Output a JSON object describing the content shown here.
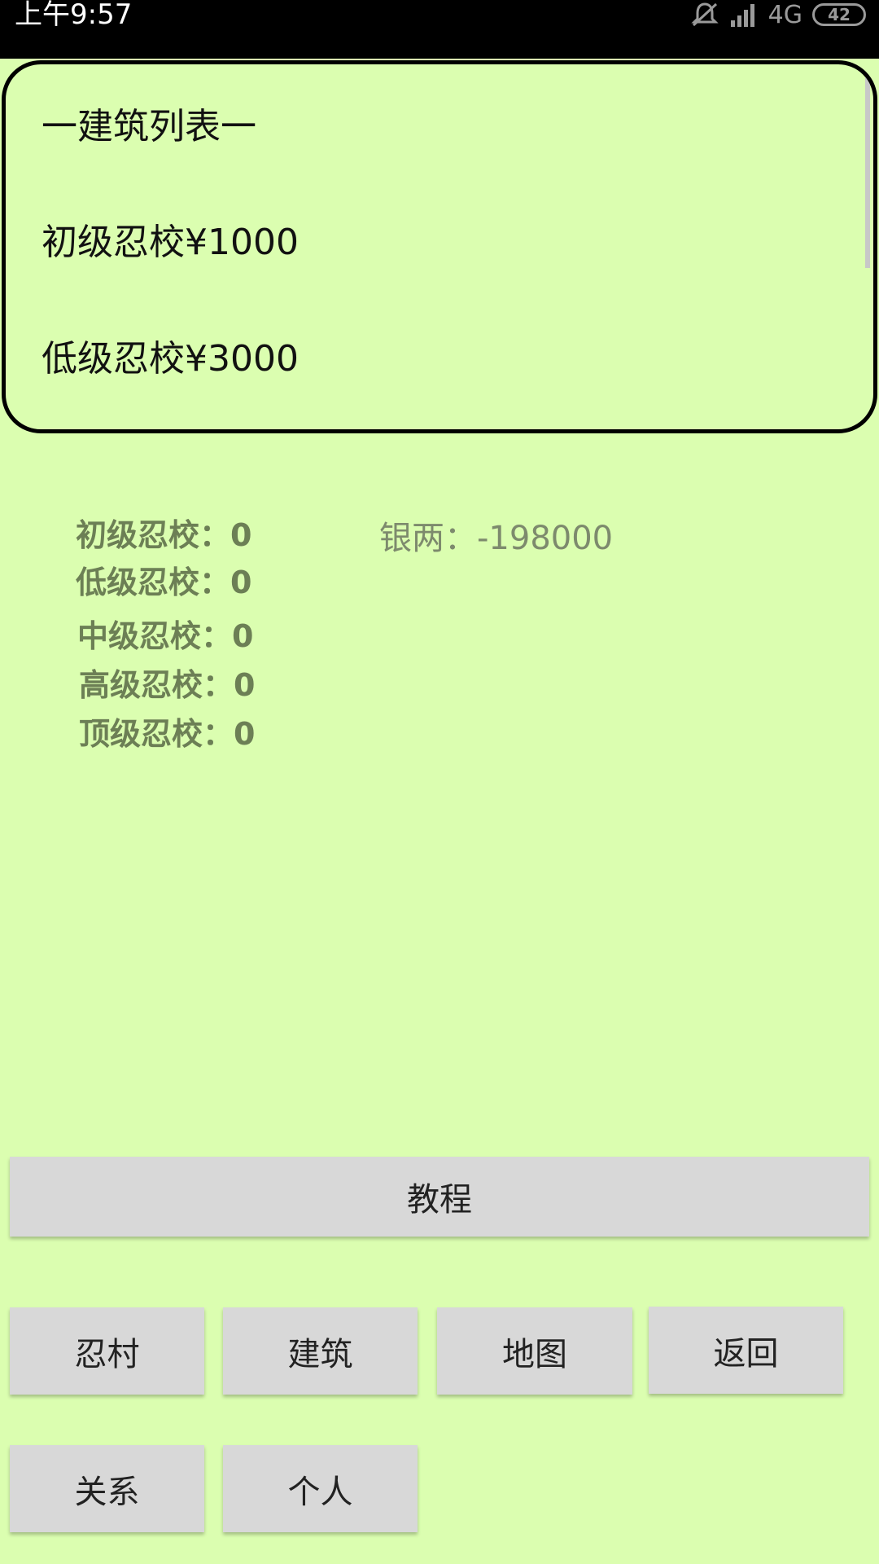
{
  "status_bar": {
    "time": "上午9:57",
    "network": "4G",
    "battery": "42",
    "icons": [
      "mute-icon",
      "signal-icon"
    ]
  },
  "building_list": {
    "title": "一建筑列表一",
    "items": [
      {
        "label": "初级忍校¥1000"
      },
      {
        "label": "低级忍校¥3000"
      }
    ]
  },
  "stats": {
    "items": [
      {
        "label": "初级忍校：0"
      },
      {
        "label": "低级忍校：0"
      },
      {
        "label": "中级忍校：0"
      },
      {
        "label": "高级忍校：0"
      },
      {
        "label": "顶级忍校：0"
      }
    ],
    "money": "银两：-198000"
  },
  "buttons": {
    "tutorial": "教程",
    "village": "忍村",
    "building": "建筑",
    "map": "地图",
    "back": "返回",
    "relations": "关系",
    "personal": "个人"
  },
  "colors": {
    "background": "#dbfeb0",
    "button": "#d8d8d8",
    "stat_text": "#6c7f55"
  }
}
